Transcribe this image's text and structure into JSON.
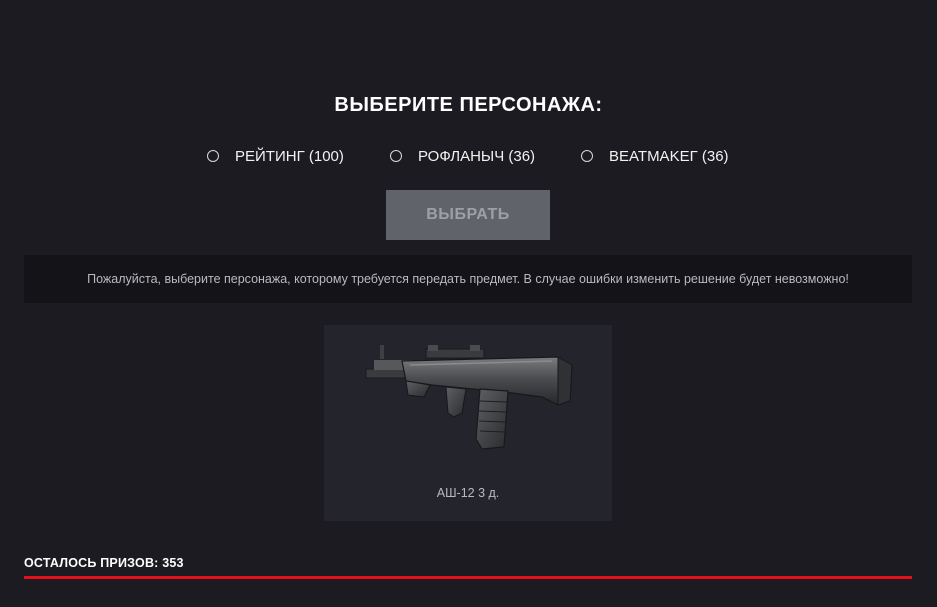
{
  "header": {
    "title": "ВЫБЕРИТЕ ПЕРСОНАЖА:"
  },
  "characters": [
    {
      "label": "РЕЙТИНГ (100)",
      "selected": false
    },
    {
      "label": "РОФЛАНЫЧ (36)",
      "selected": false
    },
    {
      "label": "BEATMAKEГ (36)",
      "selected": false
    }
  ],
  "actions": {
    "choose_label": "ВЫБРАТЬ",
    "choose_enabled": false
  },
  "notice": {
    "text": "Пожалуйста, выберите персонажа, которому требуется передать предмет. В случае ошибки изменить решение будет невозможно!"
  },
  "item": {
    "name": "АШ-12 3 д.",
    "icon": "assault-rifle-icon"
  },
  "prizes": {
    "label": "ОСТАЛОСЬ ПРИЗОВ: 353",
    "progress": 1.0
  },
  "colors": {
    "background": "#1b1b21",
    "panel": "#131318",
    "card": "#24242c",
    "button_disabled": "#606369",
    "accent": "#e3101b"
  }
}
